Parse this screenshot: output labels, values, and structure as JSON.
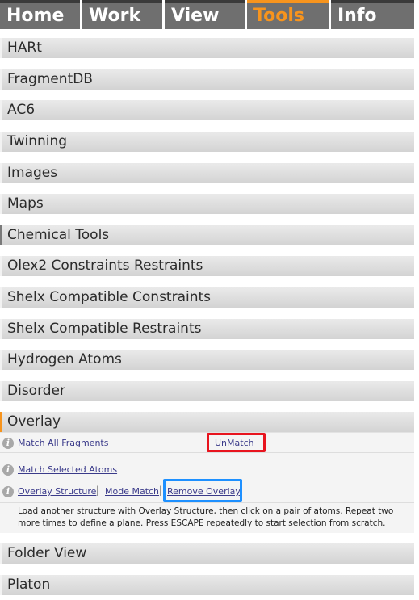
{
  "tabs": [
    "Home",
    "Work",
    "View",
    "Tools",
    "Info"
  ],
  "active_tab": "Tools",
  "sections_top": [
    "HARt",
    "FragmentDB",
    "AC6",
    "Twinning",
    "Images",
    "Maps",
    "Chemical Tools",
    "Olex2 Constraints Restraints",
    "Shelx Compatible Constraints",
    "Shelx Compatible Restraints",
    "Hydrogen Atoms",
    "Disorder"
  ],
  "overlay": {
    "title": "Overlay",
    "info_glyph": "i",
    "match_all": "Match All Fragments",
    "unmatch": "UnMatch",
    "match_selected": "Match Selected Atoms",
    "overlay_structure": "Overlay Structure",
    "separator": "|",
    "mode_match": "Mode Match",
    "remove_overlay": "Remove Overlay",
    "description": "Load another structure with Overlay Structure, then click on a pair of atoms. Repeat two more times to define a plane. Press ESCAPE repeatedly to start selection from scratch.",
    "highlight_colors": {
      "unmatch": "#e8141e",
      "remove_overlay": "#1e90ff"
    }
  },
  "sections_bottom": [
    "Folder View",
    "Platon"
  ],
  "colors": {
    "accent": "#f7941d",
    "tab_bg": "#6f6f6f",
    "link": "#3a3a8a"
  }
}
